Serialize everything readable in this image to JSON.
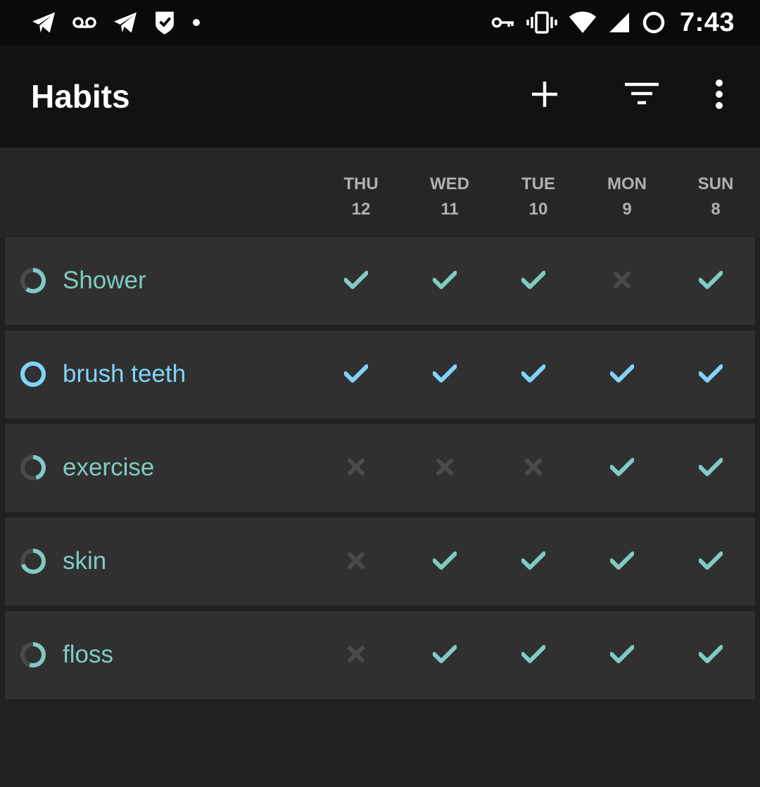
{
  "status_bar": {
    "time": "7:43",
    "left_icons": [
      "telegram-icon",
      "voicemail-icon",
      "telegram-icon",
      "shield-check-icon",
      "notification-dot-icon"
    ],
    "right_icons": [
      "vpn-key-icon",
      "vibrate-icon",
      "wifi-icon",
      "cell-signal-icon",
      "sync-ring-icon"
    ]
  },
  "app_bar": {
    "title": "Habits",
    "actions": [
      {
        "name": "add-habit-button",
        "icon": "plus-icon"
      },
      {
        "name": "filter-button",
        "icon": "filter-icon"
      },
      {
        "name": "overflow-menu-button",
        "icon": "more-vert-icon"
      }
    ]
  },
  "days": [
    {
      "weekday": "THU",
      "date": "12"
    },
    {
      "weekday": "WED",
      "date": "11"
    },
    {
      "weekday": "TUE",
      "date": "10"
    },
    {
      "weekday": "MON",
      "date": "9"
    },
    {
      "weekday": "SUN",
      "date": "8"
    }
  ],
  "colors": {
    "teal": "#80cbc4",
    "light_blue": "#81d4fa",
    "unchecked": "#4a4a4a",
    "ring_track": "#4a4a4a"
  },
  "habits": [
    {
      "name": "Shower",
      "color": "#80cbc4",
      "score": 0.6,
      "checks": [
        true,
        true,
        true,
        false,
        true
      ]
    },
    {
      "name": "brush teeth",
      "color": "#81d4fa",
      "score": 1.0,
      "checks": [
        true,
        true,
        true,
        true,
        true
      ]
    },
    {
      "name": "exercise",
      "color": "#80cbc4",
      "score": 0.45,
      "checks": [
        false,
        false,
        false,
        true,
        true
      ]
    },
    {
      "name": "skin",
      "color": "#80cbc4",
      "score": 0.7,
      "checks": [
        false,
        true,
        true,
        true,
        true
      ]
    },
    {
      "name": "floss",
      "color": "#80cbc4",
      "score": 0.55,
      "checks": [
        false,
        true,
        true,
        true,
        true
      ]
    }
  ]
}
